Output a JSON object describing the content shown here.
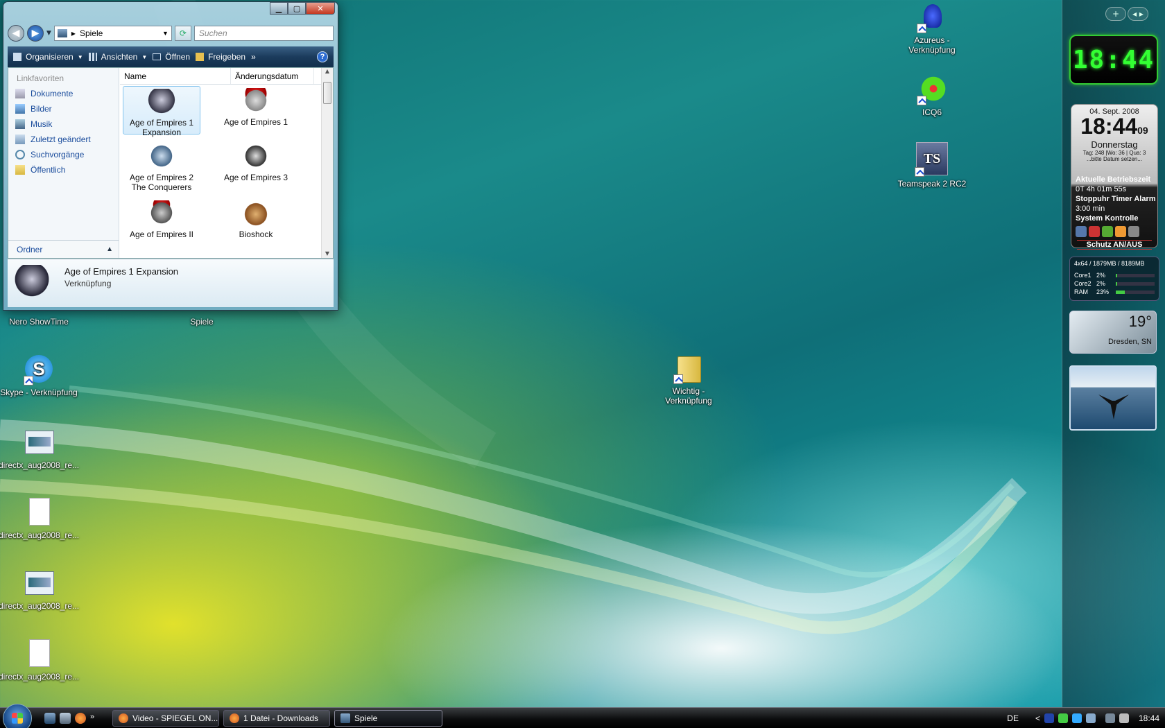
{
  "explorer": {
    "address": "Spiele",
    "search_placeholder": "Suchen",
    "toolbar": {
      "organize": "Organisieren",
      "views": "Ansichten",
      "open": "Öffnen",
      "share": "Freigeben",
      "more": "»",
      "help": "?"
    },
    "navpane": {
      "title": "Linkfavoriten",
      "items": [
        "Dokumente",
        "Bilder",
        "Musik",
        "Zuletzt geändert",
        "Suchvorgänge",
        "Öffentlich"
      ],
      "footer": "Ordner"
    },
    "columns": {
      "name": "Name",
      "date": "Änderungsdatum",
      "more": "»"
    },
    "files": [
      {
        "line1": "Age of Empires 1",
        "line2": "Expansion"
      },
      {
        "line1": "Age of Empires 1",
        "line2": ""
      },
      {
        "line1": "Age of Empires 2",
        "line2": "The Conquerers"
      },
      {
        "line1": "Age of Empires 3",
        "line2": ""
      },
      {
        "line1": "Age of Empires II",
        "line2": ""
      },
      {
        "line1": "Bioshock",
        "line2": ""
      }
    ],
    "details": {
      "name": "Age of Empires 1 Expansion",
      "type": "Verknüpfung"
    }
  },
  "desktop": {
    "icons_left": [
      {
        "label": "Nero ShowTime"
      },
      {
        "label": "Skype - Verknüpfung"
      },
      {
        "label": "directx_aug2008_re..."
      },
      {
        "label": "directx_aug2008_re..."
      },
      {
        "label": "directx_aug2008_re..."
      },
      {
        "label": "directx_aug2008_re..."
      }
    ],
    "spiele_label": "Spiele",
    "wichtig_line1": "Wichtig -",
    "wichtig_line2": "Verknüpfung",
    "azureus_line1": "Azureus -",
    "azureus_line2": "Verknüpfung",
    "icq_label": "ICQ6",
    "ts_label": "Teamspeak 2 RC2"
  },
  "sidebar": {
    "add": "+",
    "nav": "◂ ▸",
    "clock_digital": "18:44",
    "calendar": {
      "date": "04. Sept. 2008",
      "time": "18:44",
      "seconds": "09",
      "weekday": "Donnerstag",
      "week_info": "Tag: 248 |Wo: 36 | Qua: 3",
      "set_date": "...bitte Datum setzen...",
      "uptime_label": "Aktuelle Betriebszeit",
      "uptime_value": "0T 4h 01m 55s",
      "timer_label": "Stoppuhr Timer Alarm",
      "timer_value": "3:00 min",
      "control_label": "System Kontrolle",
      "protect_label": "Schutz AN/AUS"
    },
    "cpu": {
      "header": "4x64 / 1879MB / 8189MB",
      "rows": [
        {
          "label": "Core1",
          "pct": "2%",
          "value": 0.02
        },
        {
          "label": "Core2",
          "pct": "2%",
          "value": 0.02
        },
        {
          "label": "RAM",
          "pct": "23%",
          "value": 0.23
        }
      ]
    },
    "weather": {
      "temp": "19°",
      "city": "Dresden, SN"
    }
  },
  "taskbar": {
    "buttons": [
      {
        "label": "Video - SPIEGEL ON..."
      },
      {
        "label": "1 Datei - Downloads"
      },
      {
        "label": "Spiele"
      }
    ],
    "more": "»",
    "lang": "DE",
    "tray_arrow": "<",
    "time": "18:44"
  }
}
